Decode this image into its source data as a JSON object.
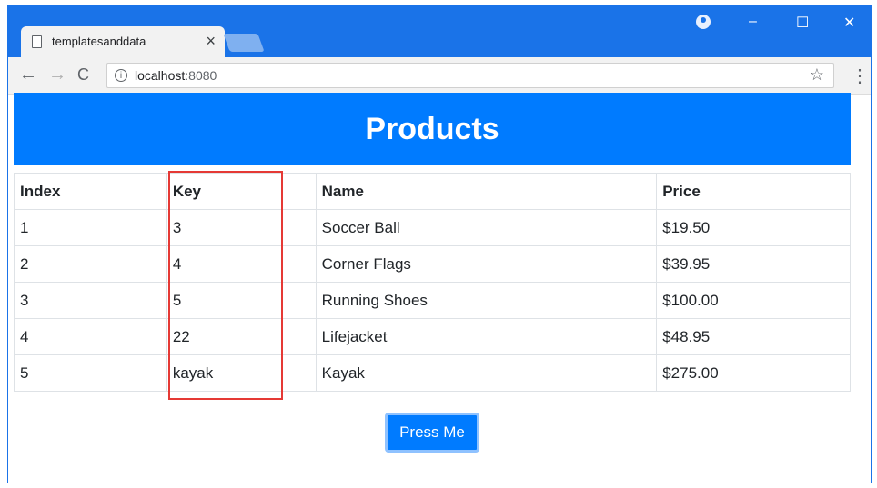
{
  "browser": {
    "tab_title": "templatesanddata",
    "tab_close": "×",
    "url_host": "localhost",
    "url_port": ":8080",
    "window_controls": {
      "minimize": "–",
      "maximize": "☐",
      "close": "✕"
    },
    "nav": {
      "back": "←",
      "forward": "→",
      "reload": "C"
    },
    "icons": [
      "page-icon",
      "account-icon",
      "info-icon",
      "star-icon",
      "menu-icon"
    ]
  },
  "page": {
    "banner_title": "Products",
    "table": {
      "headers": [
        "Index",
        "Key",
        "Name",
        "Price"
      ],
      "rows": [
        [
          "1",
          "3",
          "Soccer Ball",
          "$19.50"
        ],
        [
          "2",
          "4",
          "Corner Flags",
          "$39.95"
        ],
        [
          "3",
          "5",
          "Running Shoes",
          "$100.00"
        ],
        [
          "4",
          "22",
          "Lifejacket",
          "$48.95"
        ],
        [
          "5",
          "kayak",
          "Kayak",
          "$275.00"
        ]
      ]
    },
    "button_label": "Press Me"
  },
  "colors": {
    "chrome_blue": "#1a73e8",
    "banner_blue": "#007bff",
    "highlight_red": "#e53935"
  }
}
